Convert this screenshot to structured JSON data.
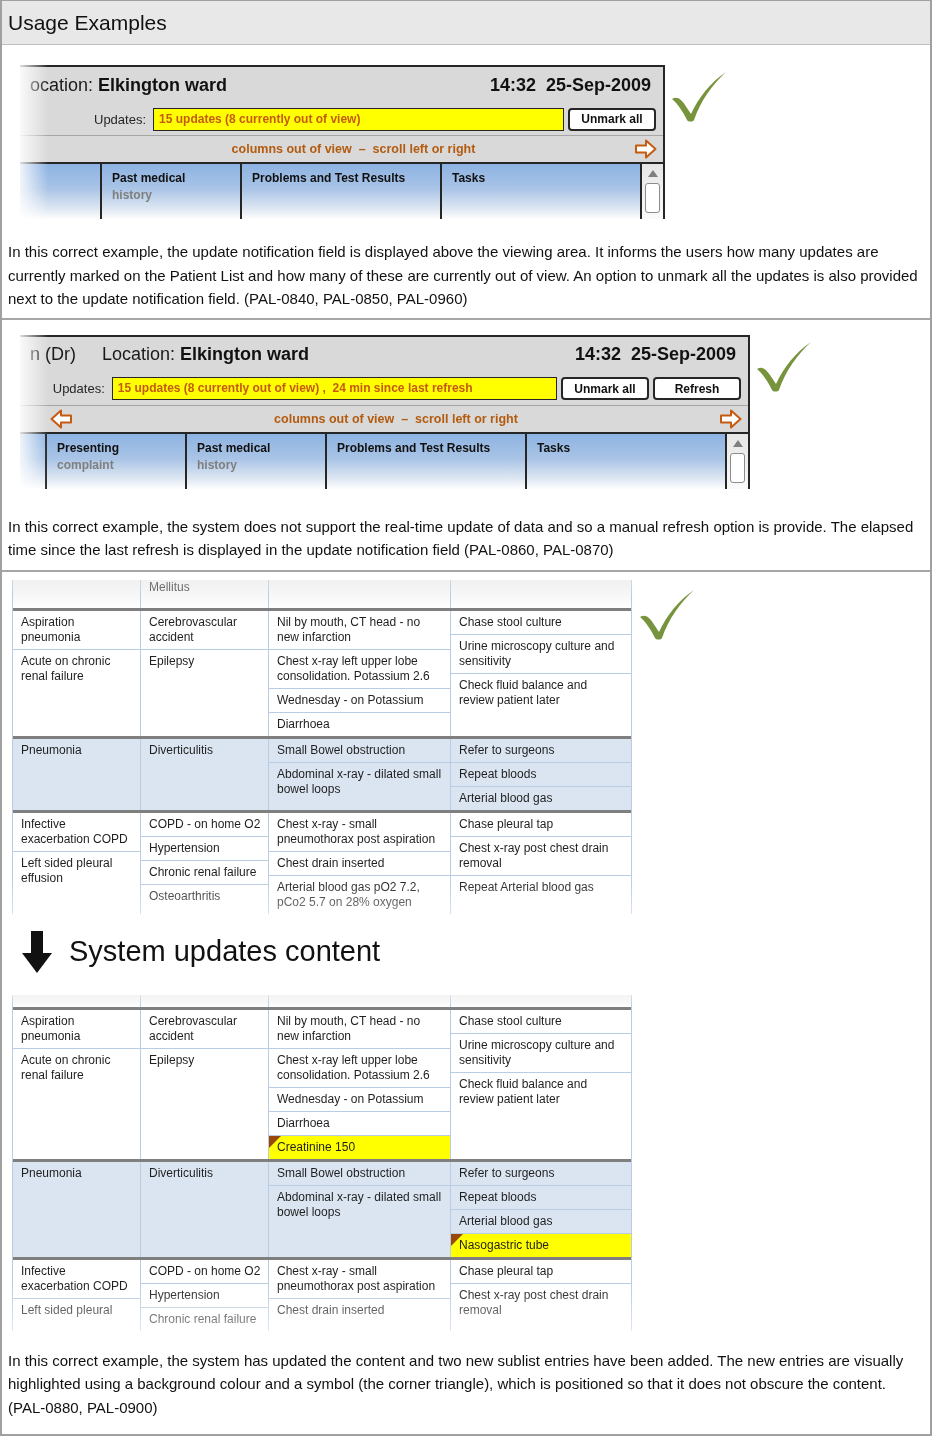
{
  "title": "Usage Examples",
  "examples": [
    {
      "kind": "panel",
      "check": true,
      "panel": {
        "location_label": "ocation:",
        "location": "Elkington ward",
        "time": "14:32",
        "date": "25-Sep-2009",
        "updates_label": "Updates:",
        "updates": "15 updates (8 currently out of view)",
        "buttons": [
          "Unmark all"
        ],
        "scroll_hint": "columns out of view  –  scroll left or right",
        "scroll_left": false,
        "scroll_right": true,
        "columns": [
          {
            "title": "Past medical",
            "subtitle": "history"
          },
          {
            "title": "Problems and Test Results"
          },
          {
            "title": "Tasks"
          }
        ]
      },
      "description": "In this correct example, the update notification field is displayed above the viewing area. It informs the users how many updates are currently marked on the Patient List and how many of these are currently out of view. An option to unmark all the updates is also provided next to the update notification field. (PAL-0840, PAL-0850, PAL-0960)"
    },
    {
      "kind": "panel",
      "check": true,
      "panel": {
        "doctor": "n (Dr)",
        "location_label": "Location:",
        "location": "Elkington ward",
        "time": "14:32",
        "date": "25-Sep-2009",
        "updates_label": "Updates:",
        "updates": "15 updates (8 currently out of view) ,  24 min since last refresh",
        "buttons": [
          "Unmark all",
          "Refresh"
        ],
        "scroll_hint": "columns out of view  –  scroll left or right",
        "scroll_left": true,
        "scroll_right": true,
        "columns": [
          {
            "title": "Presenting",
            "subtitle": "complaint"
          },
          {
            "title": "Past medical",
            "subtitle": "history"
          },
          {
            "title": "Problems and Test Results"
          },
          {
            "title": "Tasks"
          }
        ]
      },
      "description": "In this correct example, the system does not support the real-time update of data and so a manual refresh option is provide. The elapsed time since the last refresh is displayed in the update notification field (PAL-0860, PAL-0870)"
    },
    {
      "kind": "tables",
      "check": true,
      "before_update": {
        "top_row": {
          "column_2": "Mellitus"
        },
        "groups": [
          {
            "shaded": false,
            "columns": [
              [
                {
                  "text": "Aspiration pneumonia",
                  "new": false
                },
                {
                  "text": "Acute on chronic renal failure",
                  "new": false
                }
              ],
              [
                {
                  "text": "Cerebrovascular accident",
                  "new": false
                },
                {
                  "text": "Epilepsy",
                  "new": false
                }
              ],
              [
                {
                  "text": "Nil by mouth, CT head - no new infarction",
                  "new": false
                },
                {
                  "text": "Chest x-ray left upper lobe consolidation. Potassium 2.6",
                  "new": false
                },
                {
                  "text": "Wednesday - on Potassium",
                  "new": false
                },
                {
                  "text": "Diarrhoea",
                  "new": false
                }
              ],
              [
                {
                  "text": "Chase stool culture",
                  "new": false
                },
                {
                  "text": "Urine microscopy culture and sensitivity",
                  "new": false
                },
                {
                  "text": "Check fluid balance and review patient later",
                  "new": false
                }
              ]
            ]
          },
          {
            "shaded": true,
            "columns": [
              [
                {
                  "text": "Pneumonia",
                  "new": false
                }
              ],
              [
                {
                  "text": "Diverticulitis",
                  "new": false
                }
              ],
              [
                {
                  "text": "Small Bowel obstruction",
                  "new": false
                },
                {
                  "text": "Abdominal x-ray - dilated small bowel loops",
                  "new": false
                }
              ],
              [
                {
                  "text": "Refer to surgeons",
                  "new": false
                },
                {
                  "text": "Repeat bloods",
                  "new": false
                },
                {
                  "text": "Arterial blood gas",
                  "new": false
                }
              ]
            ]
          },
          {
            "shaded": false,
            "columns": [
              [
                {
                  "text": "Infective exacerbation COPD",
                  "new": false
                },
                {
                  "text": "Left sided pleural effusion",
                  "new": false
                }
              ],
              [
                {
                  "text": "COPD - on home O2",
                  "new": false
                },
                {
                  "text": "Hypertension",
                  "new": false
                },
                {
                  "text": "Chronic renal failure",
                  "new": false
                },
                {
                  "text": "Osteoarthritis",
                  "new": false
                }
              ],
              [
                {
                  "text": "Chest x-ray - small pneumothorax post aspiration",
                  "new": false
                },
                {
                  "text": "Chest drain inserted",
                  "new": false
                },
                {
                  "text": "Arterial blood gas pO2 7.2, pCo2 5.7 on 28% oxygen",
                  "new": false
                }
              ],
              [
                {
                  "text": "Chase pleural tap",
                  "new": false
                },
                {
                  "text": "Chest x-ray post chest drain removal",
                  "new": false
                },
                {
                  "text": "Repeat Arterial blood gas",
                  "new": false
                }
              ]
            ]
          }
        ]
      },
      "caption": "System updates content",
      "after_update": {
        "groups": [
          {
            "shaded": false,
            "columns": [
              [
                {
                  "text": "Aspiration pneumonia",
                  "new": false
                },
                {
                  "text": "Acute on chronic renal failure",
                  "new": false
                }
              ],
              [
                {
                  "text": "Cerebrovascular accident",
                  "new": false
                },
                {
                  "text": "Epilepsy",
                  "new": false
                }
              ],
              [
                {
                  "text": "Nil by mouth, CT head - no new infarction",
                  "new": false
                },
                {
                  "text": "Chest x-ray left upper lobe consolidation. Potassium 2.6",
                  "new": false
                },
                {
                  "text": "Wednesday - on Potassium",
                  "new": false
                },
                {
                  "text": "Diarrhoea",
                  "new": false
                },
                {
                  "text": "Creatinine 150",
                  "new": true
                }
              ],
              [
                {
                  "text": "Chase stool culture",
                  "new": false
                },
                {
                  "text": "Urine microscopy culture and sensitivity",
                  "new": false
                },
                {
                  "text": "Check fluid balance and review patient later",
                  "new": false
                }
              ]
            ]
          },
          {
            "shaded": true,
            "columns": [
              [
                {
                  "text": "Pneumonia",
                  "new": false
                }
              ],
              [
                {
                  "text": "Diverticulitis",
                  "new": false
                }
              ],
              [
                {
                  "text": "Small Bowel obstruction",
                  "new": false
                },
                {
                  "text": "Abdominal x-ray - dilated small bowel loops",
                  "new": false
                }
              ],
              [
                {
                  "text": "Refer to surgeons",
                  "new": false
                },
                {
                  "text": "Repeat bloods",
                  "new": false
                },
                {
                  "text": "Arterial blood gas",
                  "new": false
                },
                {
                  "text": "Nasogastric tube",
                  "new": true
                }
              ]
            ]
          },
          {
            "shaded": false,
            "columns": [
              [
                {
                  "text": "Infective exacerbation COPD",
                  "new": false
                },
                {
                  "text": "Left sided pleural",
                  "new": false
                }
              ],
              [
                {
                  "text": "COPD - on home O2",
                  "new": false
                },
                {
                  "text": "Hypertension",
                  "new": false
                },
                {
                  "text": "Chronic renal failure",
                  "new": false
                }
              ],
              [
                {
                  "text": "Chest x-ray - small pneumothorax post aspiration",
                  "new": false
                },
                {
                  "text": "Chest drain inserted",
                  "new": false
                }
              ],
              [
                {
                  "text": "Chase pleural tap",
                  "new": false
                },
                {
                  "text": "Chest x-ray post chest drain removal",
                  "new": false
                }
              ]
            ]
          }
        ]
      },
      "description": "In this correct example, the system has updated the content and two new sublist entries have been added. The new entries are visually highlighted using a background colour and a symbol (the corner triangle), which is positioned so that it does not obscure the content. (PAL-0880, PAL-0900)"
    }
  ]
}
